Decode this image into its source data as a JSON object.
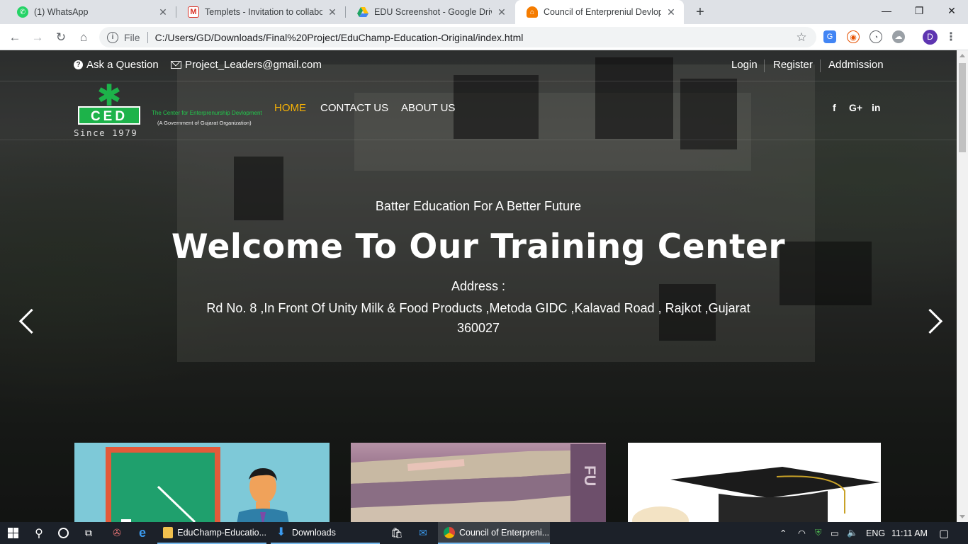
{
  "browser": {
    "tabs": [
      {
        "title": "(1) WhatsApp",
        "icon": "whatsapp-icon",
        "color": "#25d366"
      },
      {
        "title": "Templets - Invitation to collabora",
        "icon": "gmail-icon",
        "color": "#d93025"
      },
      {
        "title": "EDU Screenshot - Google Drive",
        "icon": "google-drive-icon",
        "color": "#1fa463"
      },
      {
        "title": "Council of Enterpreniul Devlopme",
        "icon": "site-icon",
        "color": "#f57c00"
      }
    ],
    "address": {
      "scheme_label": "File",
      "url": "C:/Users/GD/Downloads/Final%20Project/EduChamp-Education-Original/index.html"
    },
    "profile_initial": "D"
  },
  "page": {
    "topbar": {
      "ask_label": "Ask a Question",
      "email": "Project_Leaders@gmail.com",
      "login_label": "Login",
      "register_label": "Register",
      "admission_label": "Addmission"
    },
    "logo": {
      "letters": "CED",
      "since": "Since 1979",
      "tagline": "The Center for Enterprenurship Devlopment",
      "subtagline": "(A Government of Gujarat Organization)"
    },
    "nav": {
      "home": "HOME",
      "contact": "CONTACT US",
      "about": "ABOUT US",
      "active_color": "#f7b205"
    },
    "social": {
      "facebook": "f",
      "google_plus": "G+",
      "linkedin": "in"
    },
    "hero": {
      "subtitle": "Batter Education For A Better Future",
      "title": "Welcome To Our Training Center",
      "address_label": "Address :",
      "address": "Rd No. 8 ,In Front Of Unity Milk & Food Products ,Metoda GIDC ,Kalavad Road , Rajkot ,Gujarat 360027"
    }
  },
  "taskbar": {
    "apps": [
      {
        "label": "EduChamp-Educatio..."
      },
      {
        "label": "Downloads"
      },
      {
        "label": "Council of Enterpreni..."
      }
    ],
    "language": "ENG",
    "time": "11:11 AM"
  }
}
